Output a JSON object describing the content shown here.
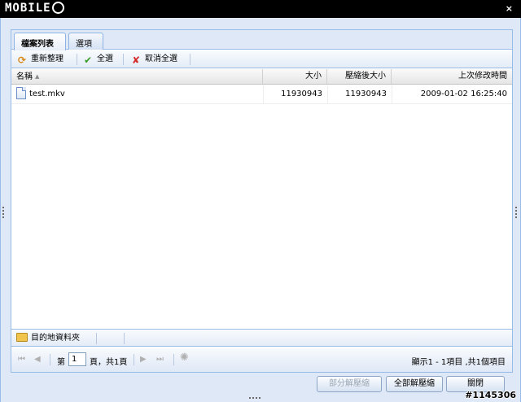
{
  "logo": {
    "text": "MOBILE"
  },
  "window": {
    "close_glyph": "×"
  },
  "tabs": [
    {
      "label": "檔案列表",
      "active": true
    },
    {
      "label": "選項",
      "active": false
    }
  ],
  "toolbar": {
    "refresh_label": "重新整理",
    "select_all_label": "全選",
    "deselect_all_label": "取消全選"
  },
  "grid": {
    "columns": [
      "名稱",
      "大小",
      "壓縮後大小",
      "上次修改時間"
    ],
    "rows": [
      {
        "name": "test.mkv",
        "size": "11930943",
        "compressed": "11930943",
        "modified": "2009-01-02 16:25:40"
      }
    ]
  },
  "destination": {
    "label": "目的地資料夾"
  },
  "pager": {
    "page_prefix": "第",
    "page_value": "1",
    "page_suffix": "頁，共1頁",
    "summary": "顯示1 - 1項目 ,共1個項目"
  },
  "buttons": {
    "partial_extract": "部分解壓縮",
    "extract_all": "全部解壓縮",
    "close": "關閉"
  },
  "watermark": "#1145306",
  "colors": {
    "accent": "#99bbe8",
    "window_bg": "#dfe8f6",
    "titlebar": "#000000"
  }
}
